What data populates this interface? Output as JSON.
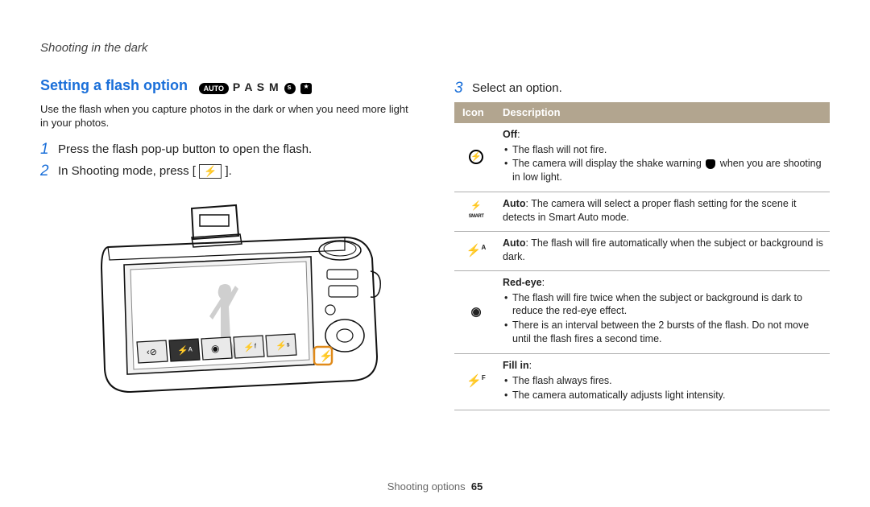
{
  "header": "Shooting in the dark",
  "section_title": "Setting a flash option",
  "modes": {
    "auto": "AUTO",
    "pasm": "P A S M"
  },
  "intro": "Use the flash when you capture photos in the dark or when you need more light in your photos.",
  "steps": {
    "s1": {
      "num": "1",
      "text": "Press the flash pop-up button to open the flash."
    },
    "s2": {
      "num": "2",
      "text_a": "In Shooting mode, press [",
      "text_b": "]."
    },
    "s3": {
      "num": "3",
      "text": "Select an option."
    }
  },
  "table": {
    "th_icon": "Icon",
    "th_desc": "Description",
    "rows": {
      "off": {
        "title": "Off",
        "b1": "The flash will not fire.",
        "b2a": "The camera will display the shake warning ",
        "b2b": " when you are shooting in low light."
      },
      "smart": {
        "label": "Auto",
        "text": ": The camera will select a proper flash setting for the scene it detects in Smart Auto mode."
      },
      "auto": {
        "label": "Auto",
        "text": ": The flash will fire automatically when the subject or background is dark."
      },
      "redeye": {
        "title": "Red-eye",
        "b1": "The flash will fire twice when the subject or background is dark to reduce the red-eye effect.",
        "b2": "There is an interval between the 2 bursts of the flash. Do not move until the flash fires a second time."
      },
      "fillin": {
        "title": "Fill in",
        "b1": "The flash always fires.",
        "b2": "The camera automatically adjusts light intensity."
      }
    }
  },
  "footer": {
    "section": "Shooting options",
    "page": "65"
  }
}
